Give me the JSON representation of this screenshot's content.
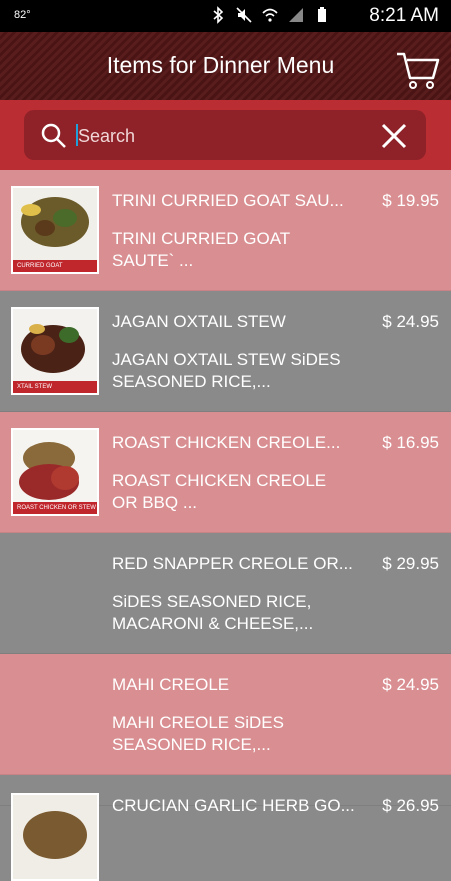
{
  "status_bar": {
    "temp": "82°",
    "time": "8:21 AM"
  },
  "header": {
    "title": "Items for Dinner Menu"
  },
  "search": {
    "placeholder": "Search"
  },
  "items": [
    {
      "name": "TRINI CURRIED GOAT SAU...",
      "desc": "TRINI CURRIED GOAT SAUTE`  ...",
      "price": "$ 19.95",
      "caption": "CURRIED GOAT",
      "bg": "pink"
    },
    {
      "name": "JAGAN OXTAIL STEW",
      "desc": "JAGAN OXTAIL STEW SiDES SEASONED RICE,...",
      "price": "$ 24.95",
      "caption": "XTAIL STEW",
      "bg": "gray"
    },
    {
      "name": "ROAST CHICKEN CREOLE...",
      "desc": "ROAST CHICKEN CREOLE OR BBQ  ...",
      "price": "$ 16.95",
      "caption": "ROAST CHICKEN OR STEW",
      "bg": "pink"
    },
    {
      "name": "RED SNAPPER CREOLE OR...",
      "desc": "SiDES SEASONED RICE, MACARONI & CHEESE,...",
      "price": "$ 29.95",
      "bg": "gray"
    },
    {
      "name": "MAHI CREOLE",
      "desc": "MAHI CREOLE SiDES SEASONED RICE,...",
      "price": "$ 24.95",
      "bg": "pink"
    },
    {
      "name": "CRUCIAN GARLIC HERB GO...",
      "price": "$ 26.95",
      "bg": "gray"
    }
  ]
}
